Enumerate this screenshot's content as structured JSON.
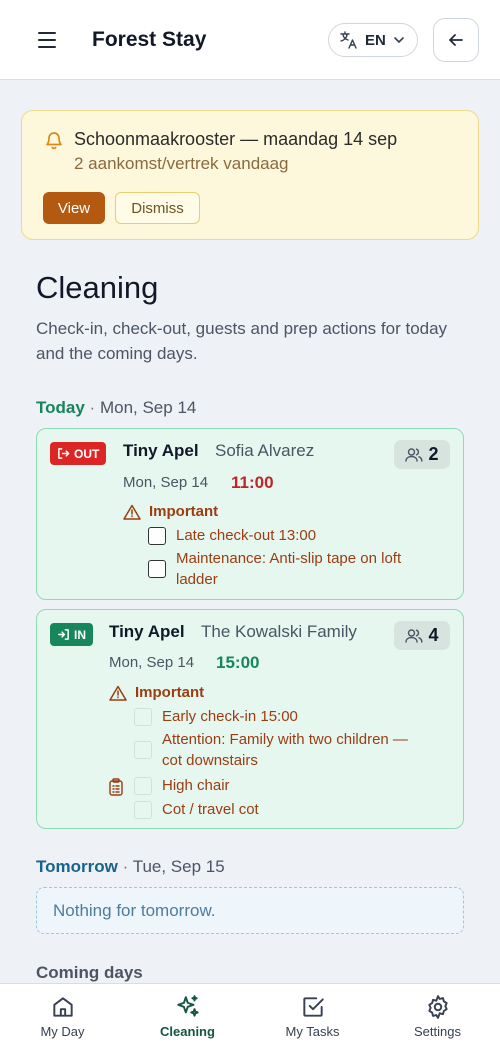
{
  "header": {
    "title": "Forest Stay",
    "language": "EN"
  },
  "notification": {
    "title": "Schoonmaakrooster — maandag 14 sep",
    "subtitle": "2 aankomst/vertrek vandaag",
    "view_label": "View",
    "dismiss_label": "Dismiss"
  },
  "page": {
    "title": "Cleaning",
    "description": "Check-in, check-out, guests and prep actions for today and the coming days."
  },
  "today": {
    "label": "Today",
    "separator": "·",
    "date": "Mon, Sep 14",
    "stays": [
      {
        "badge": "OUT",
        "unit": "Tiny Apel",
        "guest": "Sofia Alvarez",
        "date": "Mon, Sep 14",
        "time": "11:00",
        "guests": "2",
        "important_label": "Important",
        "items": [
          "Late check-out 13:00",
          "Maintenance: Anti-slip tape on loft ladder"
        ]
      },
      {
        "badge": "IN",
        "unit": "Tiny Apel",
        "guest": "The Kowalski Family",
        "date": "Mon, Sep 14",
        "time": "15:00",
        "guests": "4",
        "important_label": "Important",
        "items": [
          "Early check-in 15:00",
          "Attention: Family with two children — cot downstairs"
        ],
        "prep_items": [
          "High chair",
          "Cot / travel cot"
        ]
      }
    ]
  },
  "tomorrow": {
    "label": "Tomorrow",
    "separator": "·",
    "date": "Tue, Sep 15",
    "empty_text": "Nothing for tomorrow."
  },
  "coming_days": {
    "label": "Coming days"
  },
  "nav": {
    "items": [
      {
        "label": "My Day",
        "icon": "home-icon"
      },
      {
        "label": "Cleaning",
        "icon": "sparkle-icon",
        "active": true
      },
      {
        "label": "My Tasks",
        "icon": "checkbox-icon"
      },
      {
        "label": "Settings",
        "icon": "gear-icon"
      }
    ]
  },
  "colors": {
    "accent_green": "#16875c",
    "out_red": "#dc2626",
    "warning_brown": "#9a3d12",
    "notice_bg": "#fdf7dc",
    "view_button": "#b35a10"
  }
}
